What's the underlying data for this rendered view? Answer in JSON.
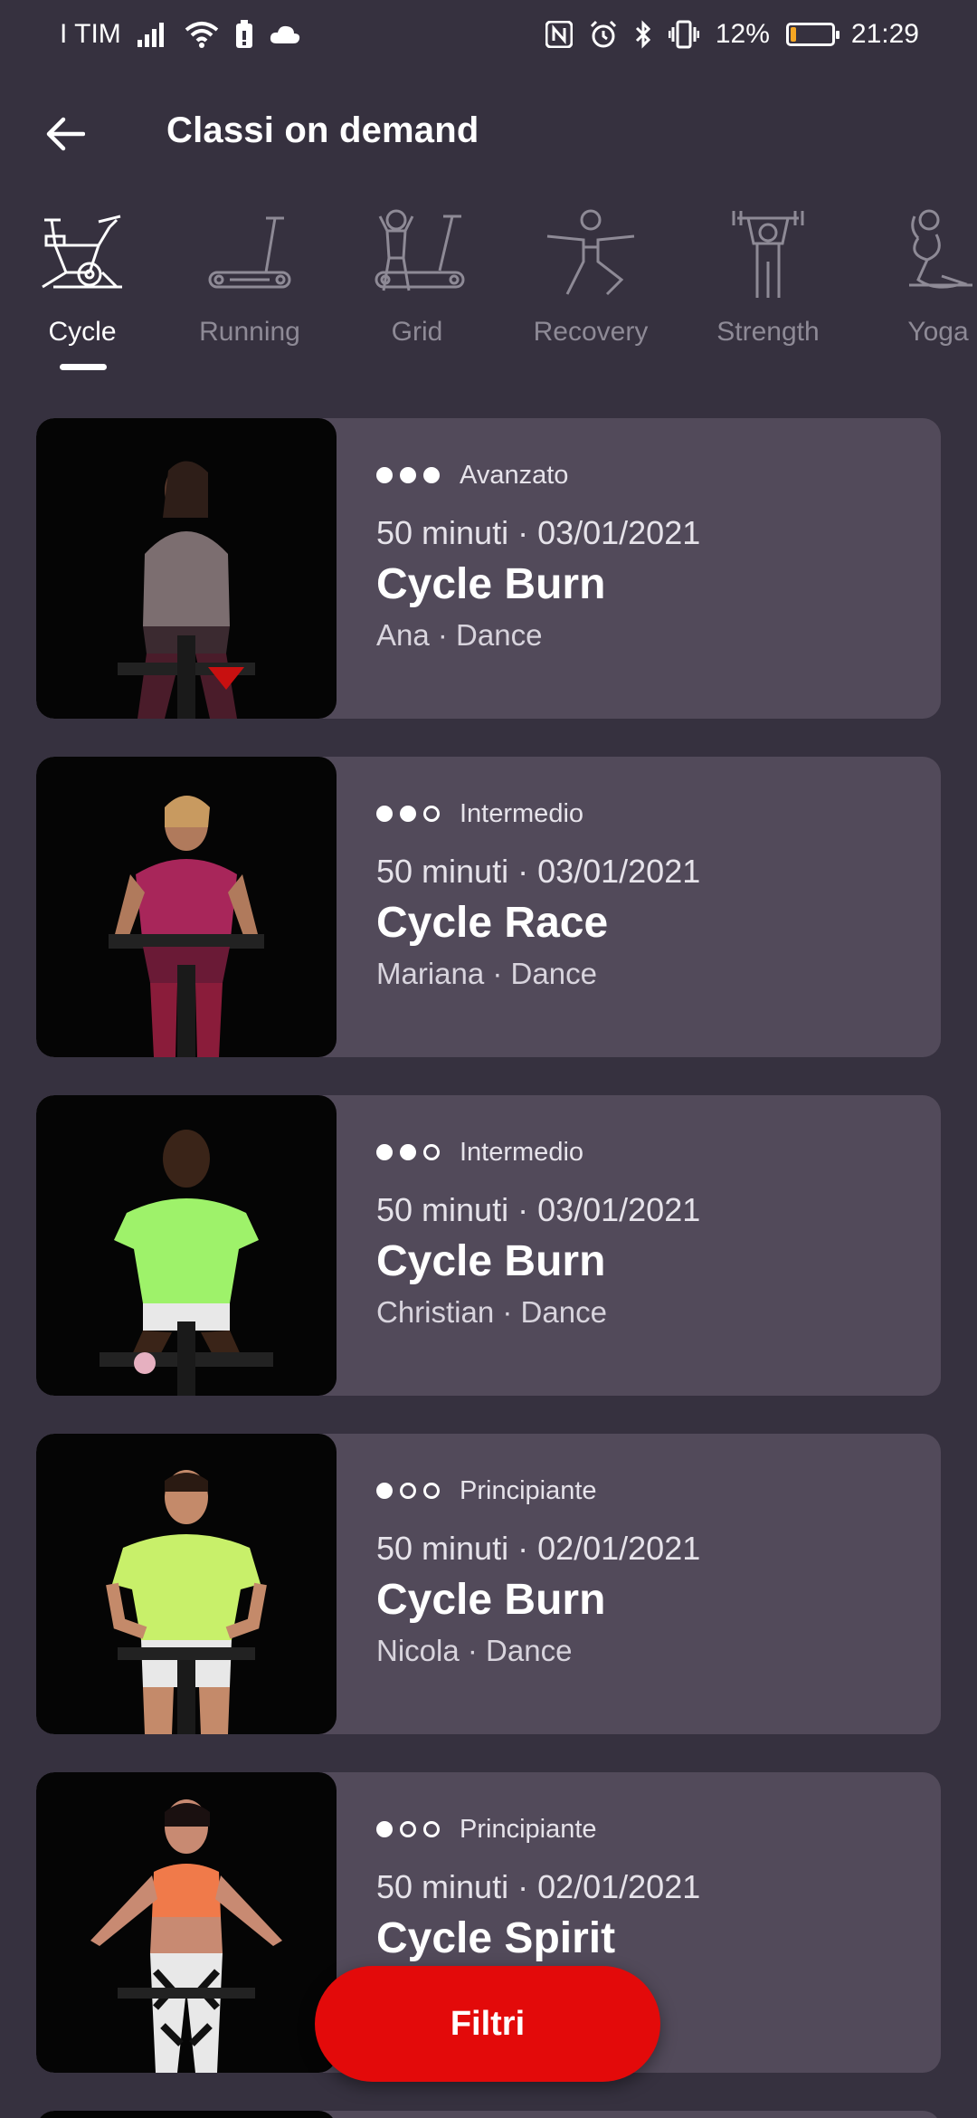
{
  "status_bar": {
    "carrier": "I TIM",
    "battery_percent": "12%",
    "time": "21:29",
    "icons": [
      "signal-icon",
      "wifi-icon",
      "sim-card-icon",
      "cloud-icon",
      "nfc-icon",
      "alarm-icon",
      "bluetooth-icon",
      "vibrate-icon",
      "battery-icon"
    ],
    "battery_level": 0.12
  },
  "header": {
    "title": "Classi on demand",
    "back_icon": "arrow-left-icon"
  },
  "categories": [
    {
      "label": "Cycle",
      "icon": "bike-icon",
      "active": true
    },
    {
      "label": "Running",
      "icon": "treadmill-icon",
      "active": false
    },
    {
      "label": "Grid",
      "icon": "grid-trainer-icon",
      "active": false
    },
    {
      "label": "Recovery",
      "icon": "recovery-pose-icon",
      "active": false
    },
    {
      "label": "Strength",
      "icon": "dumbbell-lift-icon",
      "active": false
    },
    {
      "label": "Yoga",
      "icon": "yoga-pose-icon",
      "active": false
    }
  ],
  "classes": [
    {
      "level": "Avanzato",
      "level_dots": 3,
      "meta": "50 minuti · 03/01/2021",
      "title": "Cycle Burn",
      "trainer": "Ana · Dance"
    },
    {
      "level": "Intermedio",
      "level_dots": 2,
      "meta": "50 minuti · 03/01/2021",
      "title": "Cycle Race",
      "trainer": "Mariana · Dance"
    },
    {
      "level": "Intermedio",
      "level_dots": 2,
      "meta": "50 minuti · 03/01/2021",
      "title": "Cycle Burn",
      "trainer": "Christian · Dance"
    },
    {
      "level": "Principiante",
      "level_dots": 1,
      "meta": "50 minuti · 02/01/2021",
      "title": "Cycle Burn",
      "trainer": "Nicola · Dance"
    },
    {
      "level": "Principiante",
      "level_dots": 1,
      "meta": "50 minuti · 02/01/2021",
      "title": "Cycle Spirit",
      "trainer": ""
    }
  ],
  "filter_button": {
    "label": "Filtri"
  },
  "colors": {
    "background": "#36313f",
    "card": "#524a5a",
    "accent": "#e30a0a",
    "inactive_text": "#8e8a96"
  }
}
